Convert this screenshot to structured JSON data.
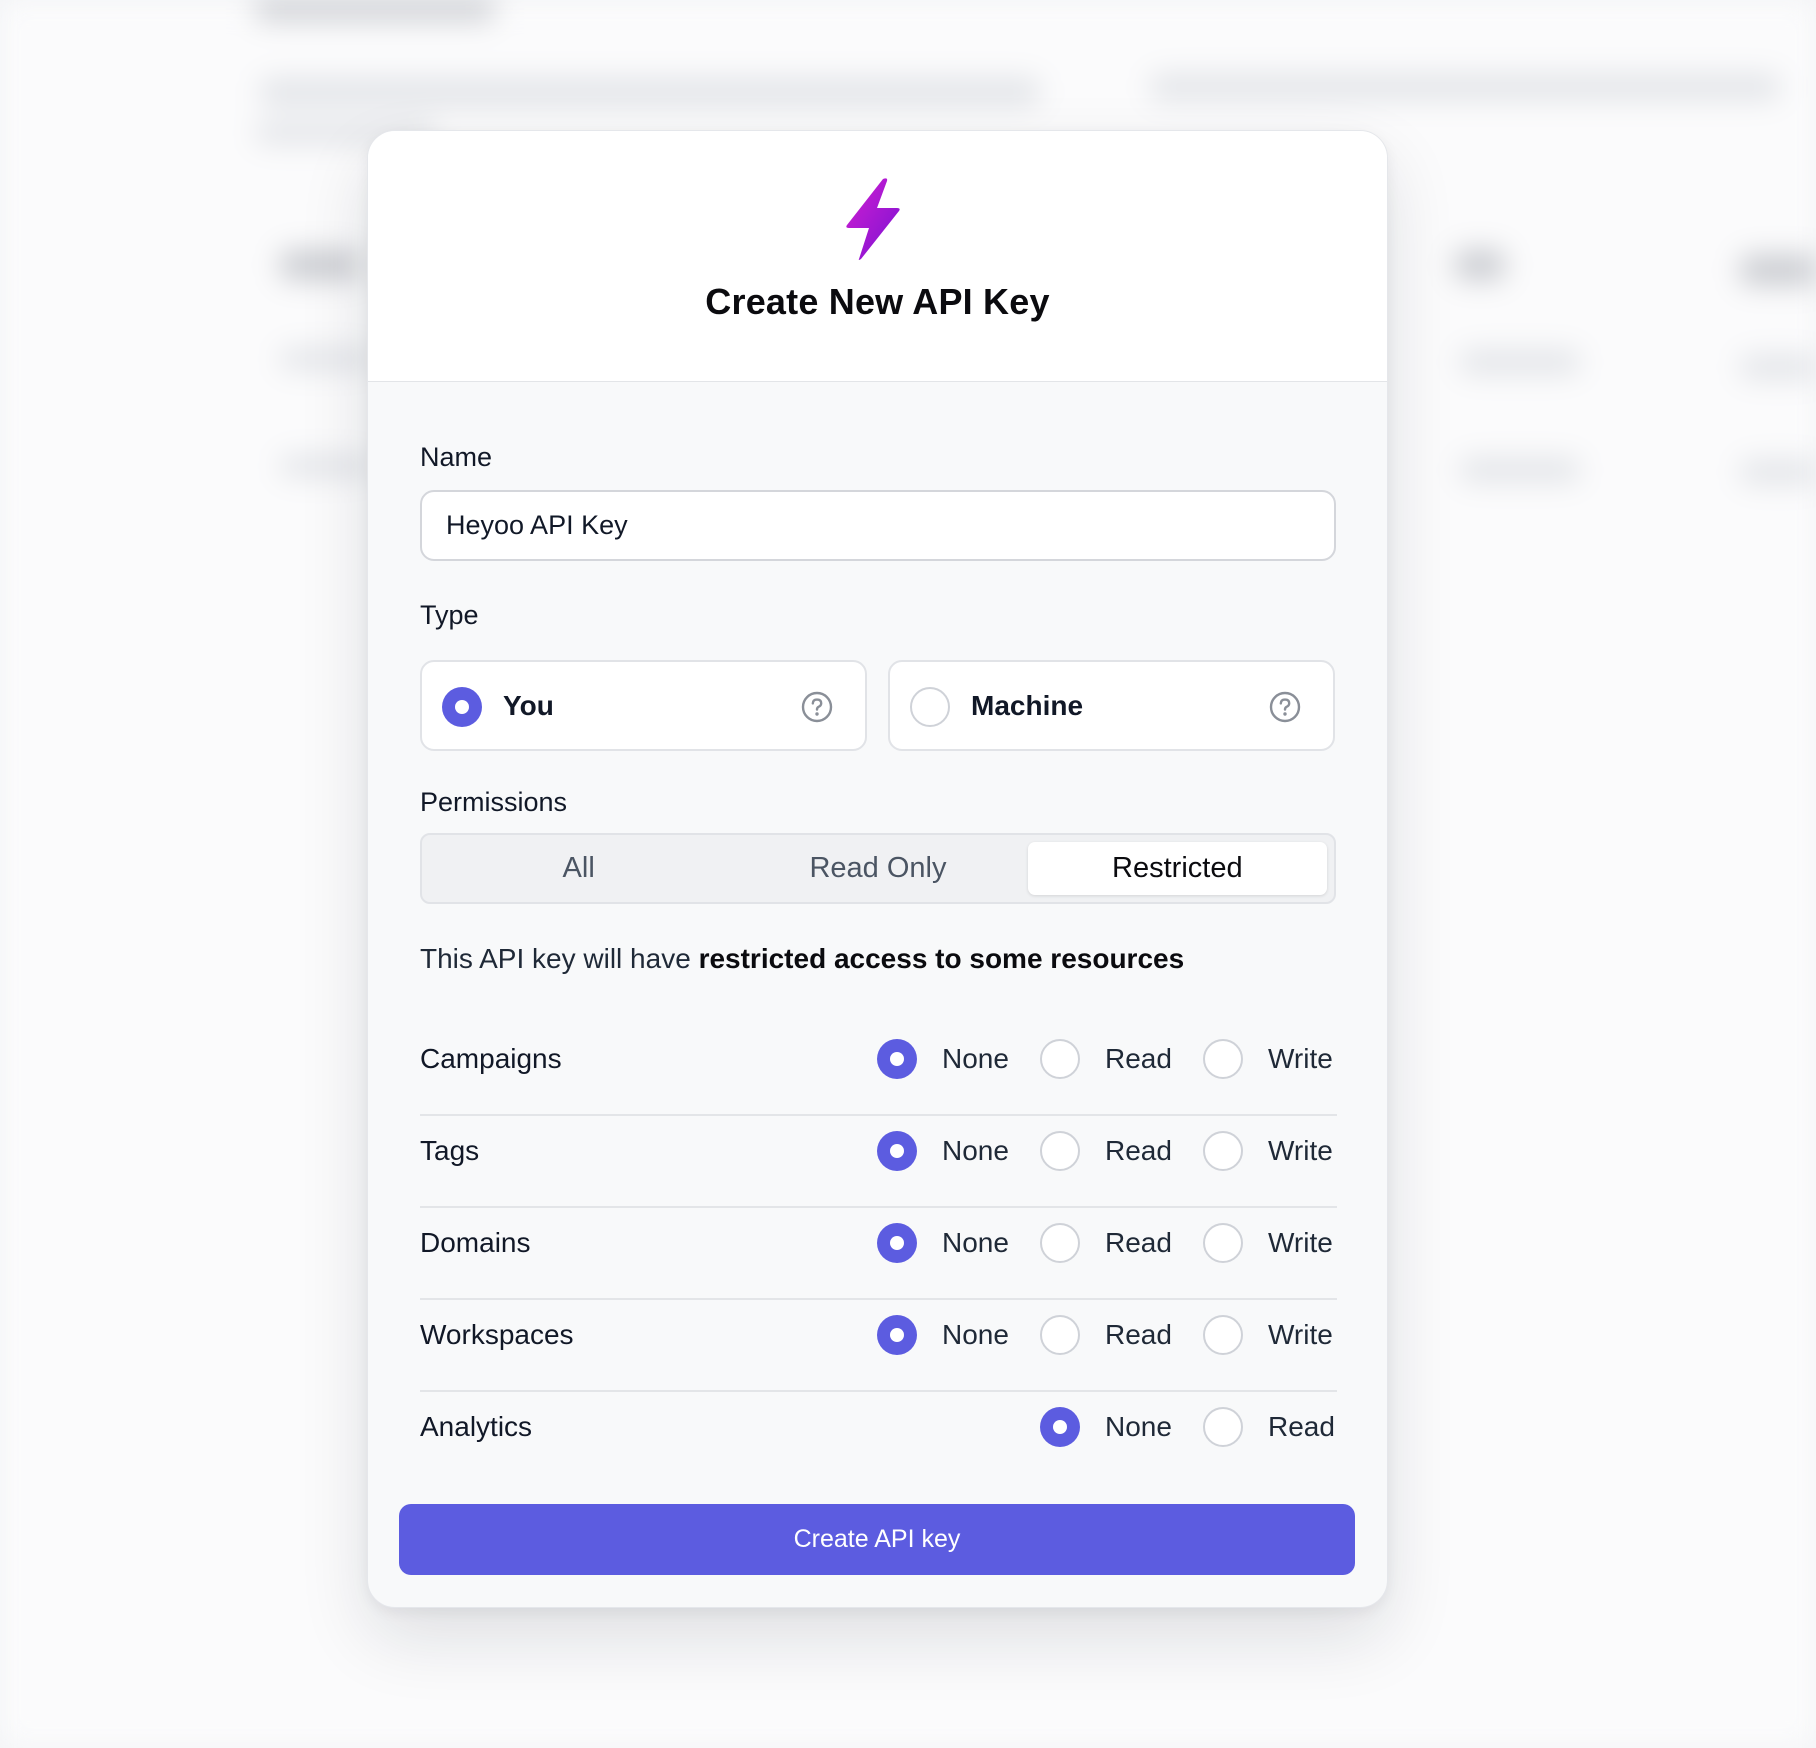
{
  "modal": {
    "title": "Create New API Key",
    "icon": "bolt-icon",
    "accent_color": "#5c5ce0"
  },
  "name_field": {
    "label": "Name",
    "value": "Heyoo API Key"
  },
  "type_field": {
    "label": "Type",
    "options": [
      {
        "label": "You",
        "selected": true
      },
      {
        "label": "Machine",
        "selected": false
      }
    ]
  },
  "permissions": {
    "label": "Permissions",
    "tabs": [
      "All",
      "Read Only",
      "Restricted"
    ],
    "active_tab": "Restricted",
    "description_prefix": "This API key will have",
    "description_emphasis": "restricted access to some resources",
    "resources": [
      {
        "name": "Campaigns",
        "options": [
          "None",
          "Read",
          "Write"
        ],
        "selected": "None"
      },
      {
        "name": "Tags",
        "options": [
          "None",
          "Read",
          "Write"
        ],
        "selected": "None"
      },
      {
        "name": "Domains",
        "options": [
          "None",
          "Read",
          "Write"
        ],
        "selected": "None"
      },
      {
        "name": "Workspaces",
        "options": [
          "None",
          "Read",
          "Write"
        ],
        "selected": "None"
      },
      {
        "name": "Analytics",
        "options": [
          "None",
          "Read"
        ],
        "selected": "None"
      }
    ]
  },
  "submit": {
    "label": "Create API key"
  }
}
